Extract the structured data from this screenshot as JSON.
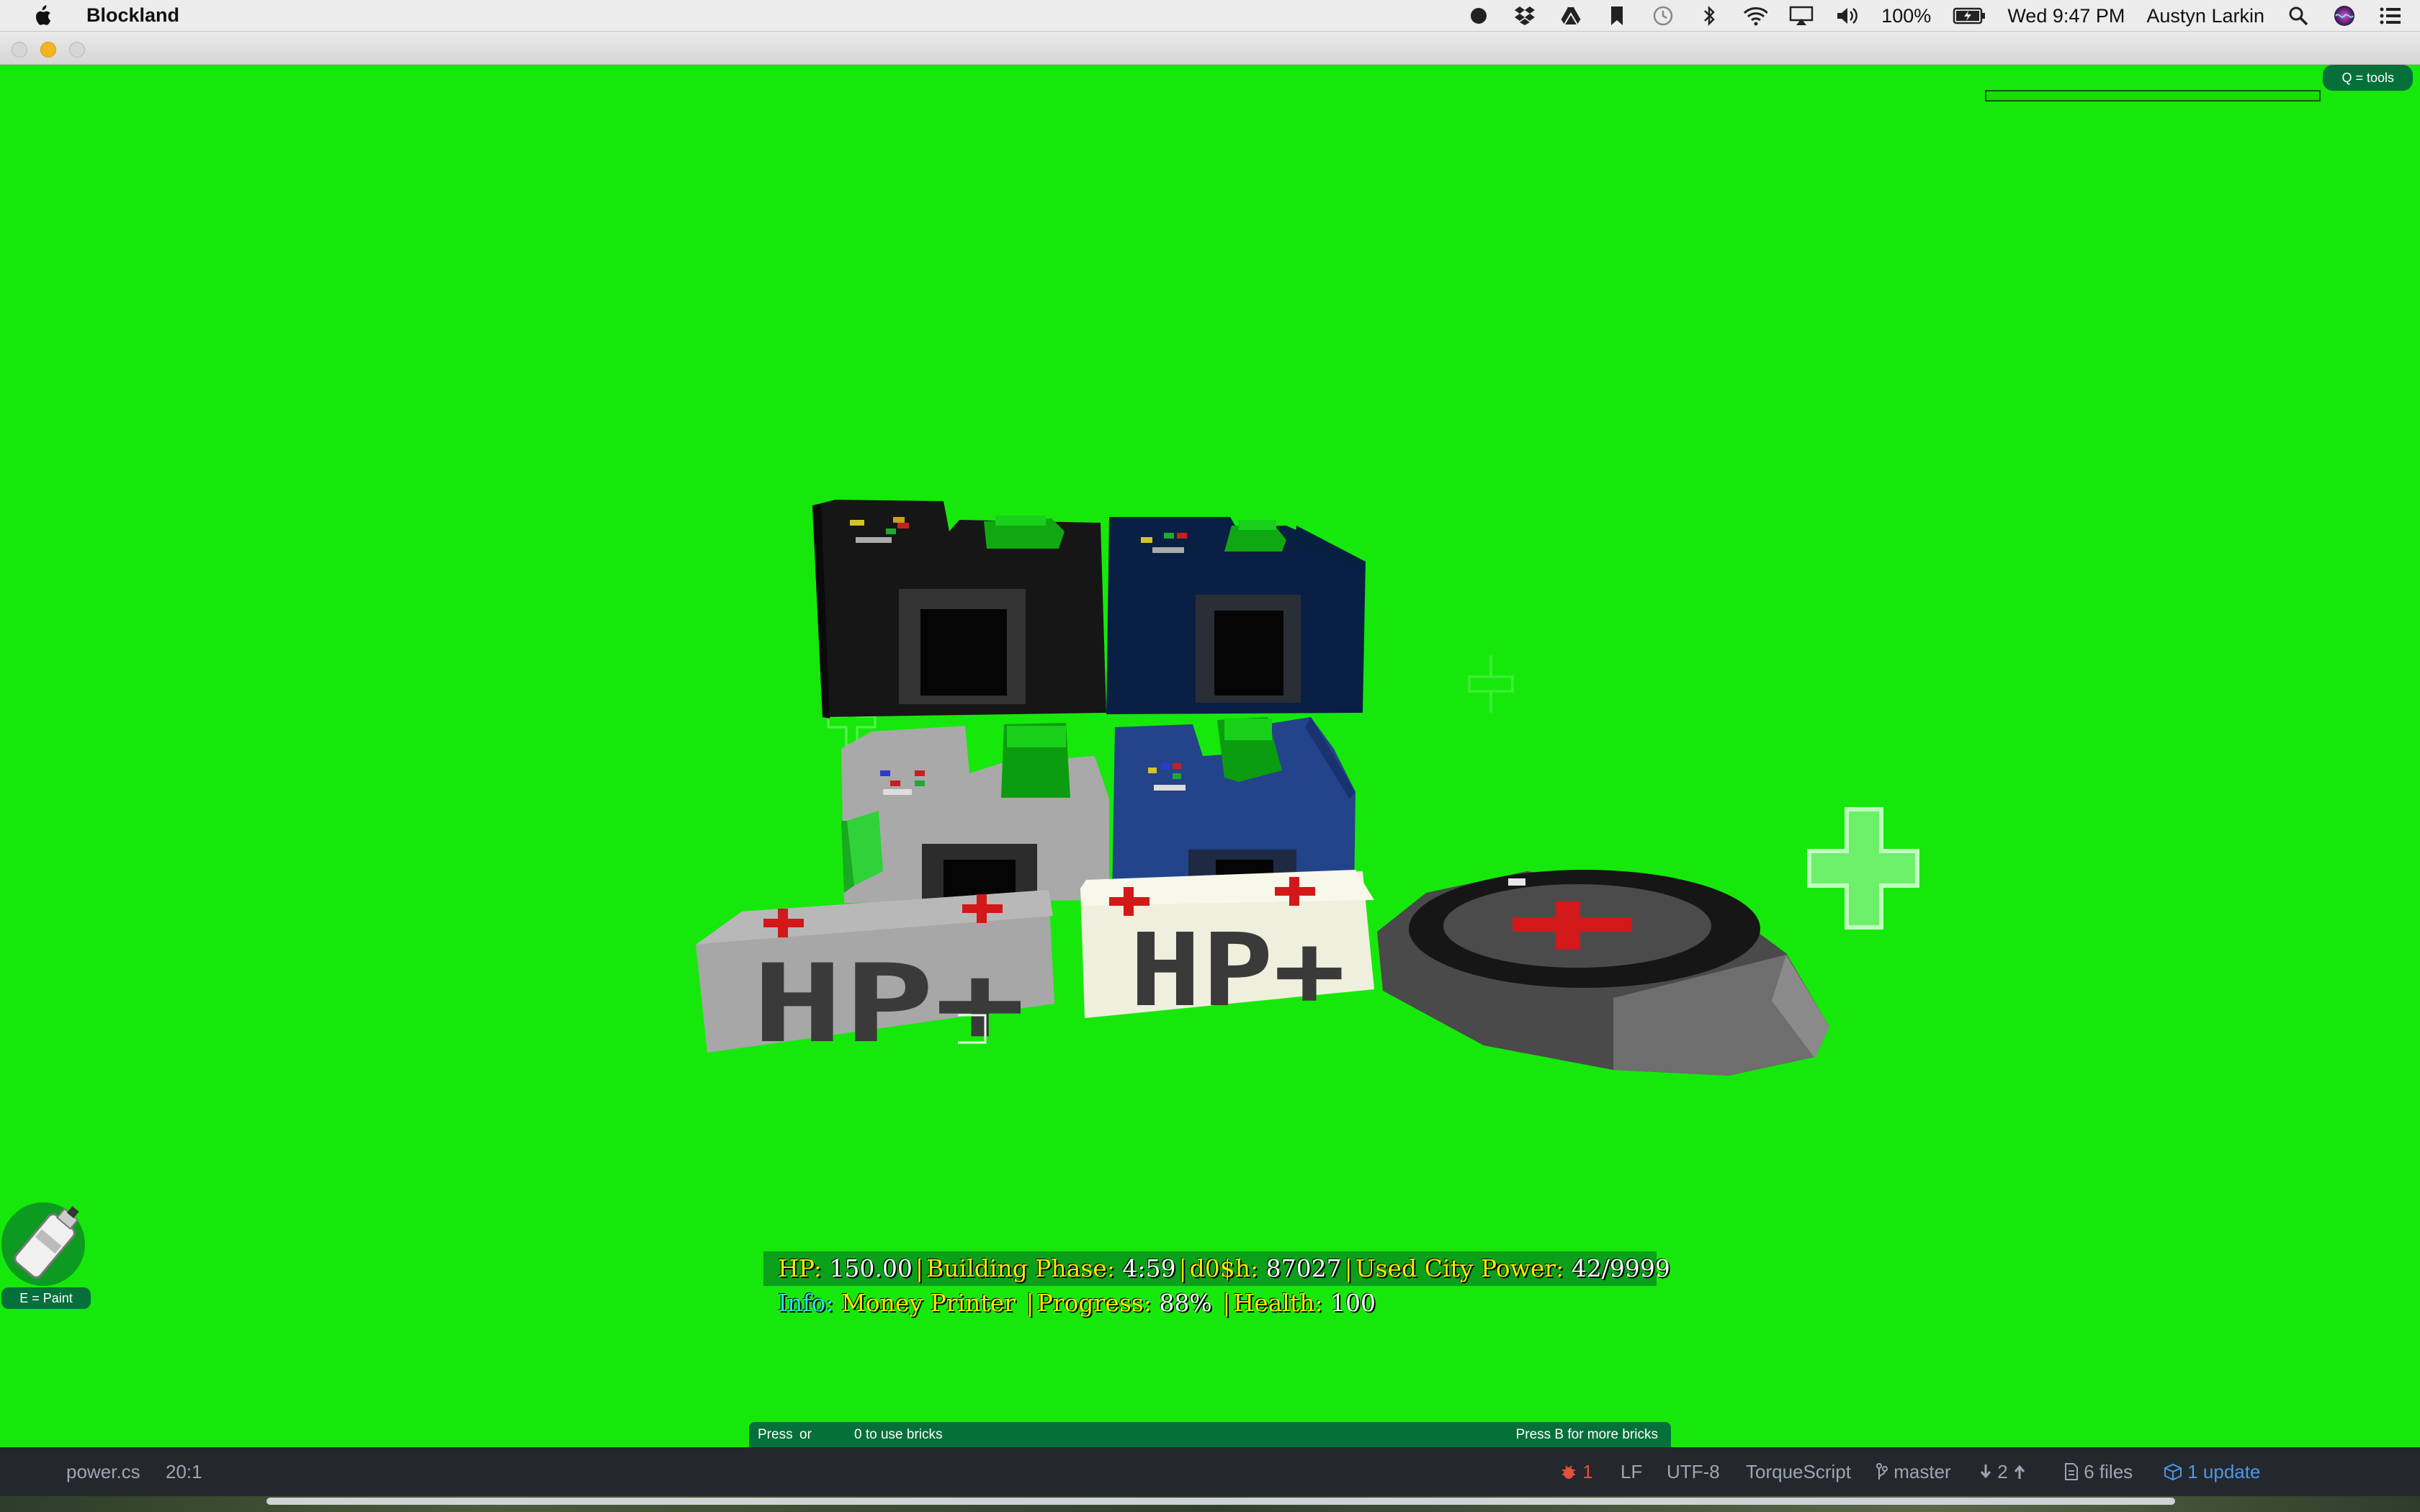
{
  "menubar": {
    "app_name": "Blockland",
    "battery": "100%",
    "clock": "Wed 9:47 PM",
    "user": "Austyn Larkin",
    "status_icons": [
      "record-icon",
      "dropbox-icon",
      "drive-icon",
      "bookmark-icon",
      "time-machine-icon",
      "bluetooth-icon",
      "wifi-icon",
      "airplay-icon",
      "volume-icon",
      "battery-icon",
      "spotlight-icon",
      "siri-icon",
      "notification-center-icon"
    ]
  },
  "game": {
    "background_color": "#17e80b",
    "tools_hint": "Q = tools",
    "paint_hint": "E = Paint",
    "scene_labels": {
      "box1": "HP+",
      "box2": "HP+"
    },
    "hud": {
      "hp_label": "HP:",
      "hp_value": "150.00",
      "phase_label": "Building Phase:",
      "phase_value": "4:59",
      "money_label": "d0$h:",
      "money_value": "87027",
      "power_label": "Used City Power:",
      "power_value": "42/9999",
      "info_label": "Info:",
      "info_value": "Money Printer",
      "progress_label": "Progress:",
      "progress_value": "88%",
      "health_label": "Health:",
      "health_value": "100"
    },
    "brick_bar": {
      "press": "Press",
      "or": "or",
      "use_bricks": "0 to use bricks",
      "more_bricks": "Press B for more bricks"
    }
  },
  "statusbar": {
    "file": "power.cs",
    "cursor": "20:1",
    "issues": "1",
    "line_ending": "LF",
    "encoding": "UTF-8",
    "grammar": "TorqueScript",
    "branch": "master",
    "sync": "2",
    "files": "6 files",
    "updates": "1 update"
  },
  "colors": {
    "hud_yellow": "#ffe800",
    "hud_cyan": "#37d9ff",
    "badge_green": "#05703a"
  }
}
